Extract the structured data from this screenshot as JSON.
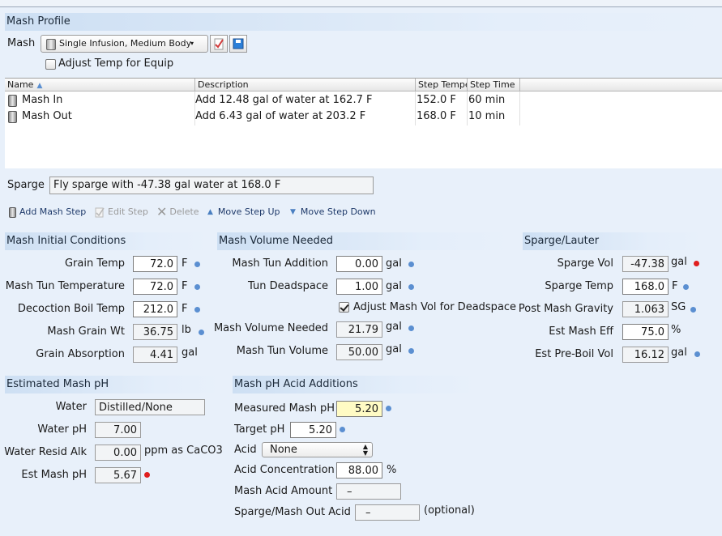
{
  "mash_profile": {
    "section_title": "Mash Profile",
    "mash_label": "Mash",
    "profile_value": "Single Infusion, Medium Body",
    "adjust_temp_label": "Adjust Temp for Equip",
    "adjust_temp_checked": false
  },
  "steps_table": {
    "columns": [
      "Name",
      "Description",
      "Step Temperature",
      "Step Time"
    ],
    "rows": [
      {
        "name": "Mash In",
        "description": "Add 12.48 gal of water at 162.7 F",
        "temp": "152.0 F",
        "time": "60 min"
      },
      {
        "name": "Mash Out",
        "description": "Add 6.43 gal of water at 203.2 F",
        "temp": "168.0 F",
        "time": "10 min"
      }
    ]
  },
  "sparge": {
    "label": "Sparge",
    "value": "Fly sparge with -47.38 gal water at 168.0 F"
  },
  "toolbar": {
    "add_step": "Add Mash Step",
    "edit_step": "Edit Step",
    "delete": "Delete",
    "move_up": "Move Step Up",
    "move_down": "Move Step Down"
  },
  "initial_conditions": {
    "title": "Mash Initial Conditions",
    "grain_temp_label": "Grain Temp",
    "grain_temp": "72.0",
    "grain_temp_unit": "F",
    "tun_temp_label": "Mash Tun Temperature",
    "tun_temp": "72.0",
    "tun_temp_unit": "F",
    "decoction_label": "Decoction Boil Temp",
    "decoction": "212.0",
    "decoction_unit": "F",
    "grain_wt_label": "Mash Grain Wt",
    "grain_wt": "36.75",
    "grain_wt_unit": "lb",
    "absorption_label": "Grain Absorption",
    "absorption": "4.41",
    "absorption_unit": "gal"
  },
  "volume_needed": {
    "title": "Mash Volume Needed",
    "tun_addition_label": "Mash Tun Addition",
    "tun_addition": "0.00",
    "tun_addition_unit": "gal",
    "deadspace_label": "Tun Deadspace",
    "deadspace": "1.00",
    "deadspace_unit": "gal",
    "adjust_vol_label": "Adjust Mash Vol for Deadspace",
    "adjust_vol_checked": true,
    "vol_needed_label": "Mash Volume Needed",
    "vol_needed": "21.79",
    "vol_needed_unit": "gal",
    "tun_volume_label": "Mash Tun Volume",
    "tun_volume": "50.00",
    "tun_volume_unit": "gal"
  },
  "sparge_lauter": {
    "title": "Sparge/Lauter",
    "sparge_vol_label": "Sparge Vol",
    "sparge_vol": "-47.38",
    "sparge_vol_unit": "gal",
    "sparge_temp_label": "Sparge Temp",
    "sparge_temp": "168.0",
    "sparge_temp_unit": "F",
    "post_gravity_label": "Post Mash Gravity",
    "post_gravity": "1.063",
    "post_gravity_unit": "SG",
    "mash_eff_label": "Est Mash Eff",
    "mash_eff": "75.0",
    "mash_eff_unit": "%",
    "preboil_label": "Est Pre-Boil Vol",
    "preboil": "16.12",
    "preboil_unit": "gal"
  },
  "mash_ph": {
    "title": "Estimated Mash pH",
    "water_label": "Water",
    "water": "Distilled/None",
    "water_ph_label": "Water pH",
    "water_ph": "7.00",
    "resid_alk_label": "Water Resid Alk",
    "resid_alk": "0.00",
    "resid_alk_unit": "ppm as CaCO3",
    "est_ph_label": "Est Mash pH",
    "est_ph": "5.67"
  },
  "acid_additions": {
    "title": "Mash pH Acid Additions",
    "measured_label": "Measured Mash pH",
    "measured": "5.20",
    "target_label": "Target pH",
    "target": "5.20",
    "acid_label": "Acid",
    "acid": "None",
    "concentration_label": "Acid Concentration",
    "concentration": "88.00",
    "concentration_unit": "%",
    "acid_amount_label": "Mash Acid Amount",
    "acid_amount": "–",
    "sparge_acid_label": "Sparge/Mash Out Acid",
    "sparge_acid": "–",
    "sparge_acid_note": "(optional)"
  },
  "colors": {
    "accent_dot": "#5b8fd1",
    "warn_dot": "#e01e1e",
    "highlight": "#fffbc4"
  }
}
